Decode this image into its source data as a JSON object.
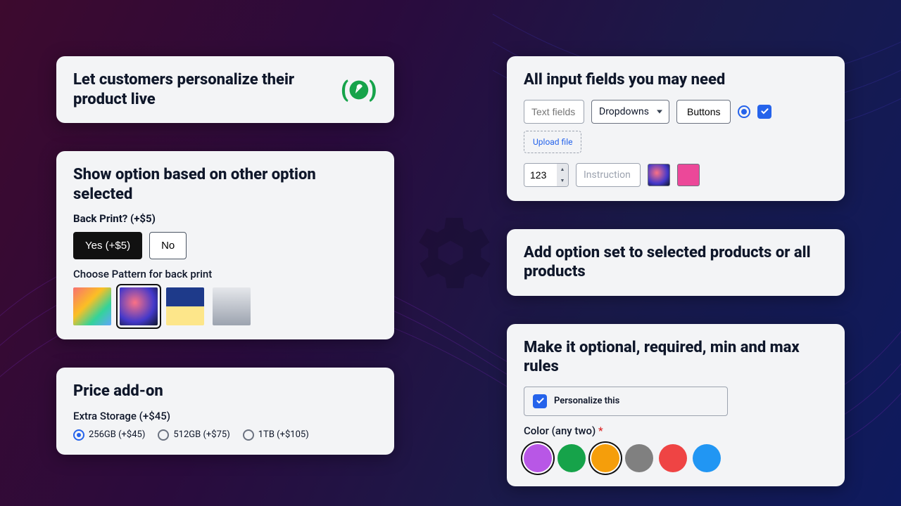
{
  "left": {
    "hero": {
      "title": "Let customers personalize their product live"
    },
    "conditional": {
      "title": "Show option based on other option selected",
      "back_print_label": "Back Print? (+$5)",
      "yes": "Yes (+$5)",
      "no": "No",
      "pattern_label": "Choose Pattern for back print"
    },
    "price": {
      "title": "Price add-on",
      "storage_label": "Extra Storage (+$45)",
      "opts": [
        "256GB (+$45)",
        "512GB (+$75)",
        "1TB (+$105)"
      ]
    }
  },
  "right": {
    "inputs": {
      "title": "All input fields you may need",
      "text_placeholder": "Text fields",
      "dropdown": "Dropdowns",
      "button": "Buttons",
      "upload": "Upload file",
      "num": "123",
      "instruction": "Instruction"
    },
    "assign": {
      "title": "Add option set to selected products or all products"
    },
    "rules": {
      "title": "Make it optional, required, min and max rules",
      "personalize": "Personalize this",
      "color_label": "Color (any two)",
      "colors": [
        "#b857e6",
        "#16a34a",
        "#f59e0b",
        "#6b7280",
        "#ef4444",
        "#2196f3"
      ]
    }
  }
}
